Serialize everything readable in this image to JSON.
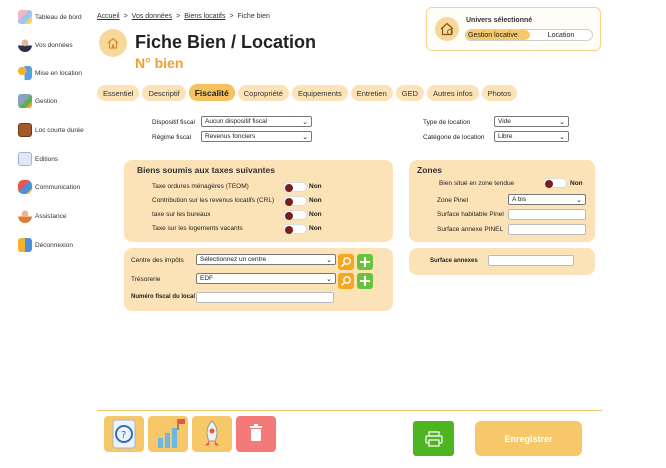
{
  "sidebar": {
    "items": [
      {
        "label": "Tableau de bord",
        "icon": "dashboard-icon"
      },
      {
        "label": "Vos données",
        "icon": "user-icon"
      },
      {
        "label": "Mise en location",
        "icon": "key-icon"
      },
      {
        "label": "Gestion",
        "icon": "management-icon"
      },
      {
        "label": "Loc courte durée",
        "icon": "suitcase-icon"
      },
      {
        "label": "Editions",
        "icon": "document-icon"
      },
      {
        "label": "Communication",
        "icon": "chat-icon"
      },
      {
        "label": "Assistance",
        "icon": "support-icon"
      },
      {
        "label": "Déconnexion",
        "icon": "logout-icon"
      }
    ]
  },
  "breadcrumb": {
    "items": [
      "Accueil",
      "Vos données",
      "Biens locatifs"
    ],
    "current": "Fiche bien",
    "separator": ">"
  },
  "page": {
    "title": "Fiche Bien / Location",
    "subtitle": "N° bien"
  },
  "universe": {
    "label": "Univers sélectionné",
    "options": [
      "Gestion locative",
      "Location"
    ],
    "selected": "Gestion locative"
  },
  "tabs": {
    "items": [
      "Essentiel",
      "Descriptif",
      "Fiscalité",
      "Copropriété",
      "Equipements",
      "Entretien",
      "GED",
      "Autres infos",
      "Photos"
    ],
    "active": "Fiscalité"
  },
  "form": {
    "dispositif_label": "Dispositif fiscal",
    "dispositif_value": "Aucun dispositif fiscal",
    "regime_label": "Régime fiscal",
    "regime_value": "Revenus fonciers",
    "type_location_label": "Type de location",
    "type_location_value": "Vide",
    "categorie_label": "Catégorie de location",
    "categorie_value": "Libre"
  },
  "taxes_panel": {
    "title": "Biens soumis aux taxes suivantes",
    "rows": [
      {
        "label": "Taxe ordures ménagères (TEOM)",
        "state": "Non"
      },
      {
        "label": "Contribution sur les revenus locatifs (CRL)",
        "state": "Non"
      },
      {
        "label": "taxe sur les bureaux",
        "state": "Non"
      },
      {
        "label": "Taxe sur les logements vacants",
        "state": "Non"
      }
    ]
  },
  "zones_panel": {
    "title": "Zones",
    "tendue_label": "Bien situé en zone tendue",
    "tendue_state": "Non",
    "pinel_label": "Zone Pinel",
    "pinel_value": "A bis",
    "surface_habitable_label": "Surface habitable Pinel",
    "surface_annexe_label": "Surface annexe PINEL"
  },
  "annexes_panel": {
    "label": "Surface annexes"
  },
  "impots_panel": {
    "centre_label": "Centre des impôts",
    "centre_value": "Sélectionnez un centre",
    "tresorerie_label": "Trésorerie",
    "tresorerie_value": "EDF",
    "numero_label": "Numéro fiscal du local"
  },
  "footer": {
    "save_label": "Enregistrer"
  },
  "colors": {
    "accent": "#f6c25f",
    "panel": "#fbe3b7",
    "orange_text": "#f0a030",
    "green": "#4db521",
    "red": "#f47a7a"
  }
}
